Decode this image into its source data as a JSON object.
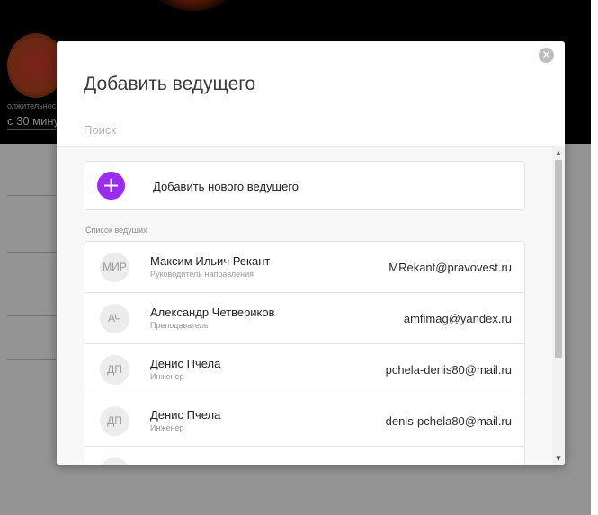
{
  "background": {
    "caption_small": "олжительнос",
    "caption_big": "с 30 мину"
  },
  "modal": {
    "title": "Добавить ведущего",
    "close_icon": "close-icon",
    "search": {
      "placeholder": "Поиск",
      "value": ""
    },
    "add_new": {
      "icon": "plus-icon",
      "label": "Добавить нового ведущего"
    },
    "section_label": "Список ведущих",
    "hosts": [
      {
        "initials": "МИР",
        "name": "Максим Ильич Рекант",
        "role": "Руководитель направления",
        "email": "MRekant@pravovest.ru"
      },
      {
        "initials": "АЧ",
        "name": "Александр Четвериков",
        "role": "Преподаватель",
        "email": "amfimag@yandex.ru"
      },
      {
        "initials": "ДП",
        "name": "Денис Пчела",
        "role": "Инженер",
        "email": "pchela-denis80@mail.ru"
      },
      {
        "initials": "ДП",
        "name": "Денис Пчела",
        "role": "Инженер",
        "email": "denis-pchela80@mail.ru"
      },
      {
        "initials": "",
        "name": "",
        "role": "",
        "email": ""
      }
    ]
  },
  "colors": {
    "accent": "#9b2bf0",
    "overlay": "#000000"
  }
}
